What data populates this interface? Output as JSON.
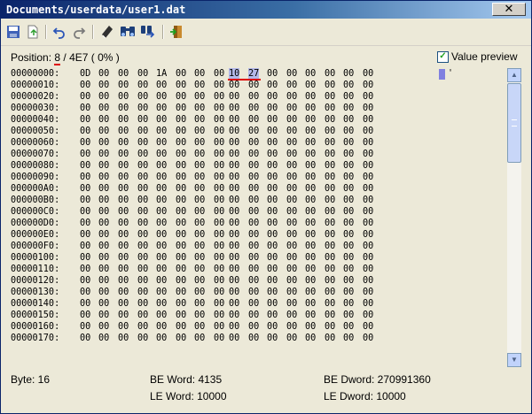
{
  "window": {
    "title": "Documents/userdata/user1.dat",
    "close_label": "✕"
  },
  "toolbar": {
    "items": [
      {
        "icon": "save-icon"
      },
      {
        "icon": "export-icon"
      },
      {
        "icon": "undo-icon"
      },
      {
        "icon": "redo-icon"
      },
      {
        "icon": "goto-icon"
      },
      {
        "icon": "find-icon"
      },
      {
        "icon": "find-next-icon"
      },
      {
        "icon": "exit-icon"
      }
    ]
  },
  "position": {
    "label": "Position:",
    "offset": "8",
    "sep": "/",
    "total": "4E7",
    "percent": "( 0% )"
  },
  "value_preview": {
    "label": "Value preview",
    "checked": true,
    "preview_char": "'"
  },
  "hex": {
    "selected_bytes": [
      8,
      9
    ],
    "rows": [
      {
        "addr": "00000000:",
        "bytes": [
          "0D",
          "00",
          "00",
          "00",
          "1A",
          "00",
          "00",
          "00",
          "10",
          "27",
          "00",
          "00",
          "00",
          "00",
          "00",
          "00"
        ]
      },
      {
        "addr": "00000010:",
        "bytes": [
          "00",
          "00",
          "00",
          "00",
          "00",
          "00",
          "00",
          "00",
          "00",
          "00",
          "00",
          "00",
          "00",
          "00",
          "00",
          "00"
        ]
      },
      {
        "addr": "00000020:",
        "bytes": [
          "00",
          "00",
          "00",
          "00",
          "00",
          "00",
          "00",
          "00",
          "00",
          "00",
          "00",
          "00",
          "00",
          "00",
          "00",
          "00"
        ]
      },
      {
        "addr": "00000030:",
        "bytes": [
          "00",
          "00",
          "00",
          "00",
          "00",
          "00",
          "00",
          "00",
          "00",
          "00",
          "00",
          "00",
          "00",
          "00",
          "00",
          "00"
        ]
      },
      {
        "addr": "00000040:",
        "bytes": [
          "00",
          "00",
          "00",
          "00",
          "00",
          "00",
          "00",
          "00",
          "00",
          "00",
          "00",
          "00",
          "00",
          "00",
          "00",
          "00"
        ]
      },
      {
        "addr": "00000050:",
        "bytes": [
          "00",
          "00",
          "00",
          "00",
          "00",
          "00",
          "00",
          "00",
          "00",
          "00",
          "00",
          "00",
          "00",
          "00",
          "00",
          "00"
        ]
      },
      {
        "addr": "00000060:",
        "bytes": [
          "00",
          "00",
          "00",
          "00",
          "00",
          "00",
          "00",
          "00",
          "00",
          "00",
          "00",
          "00",
          "00",
          "00",
          "00",
          "00"
        ]
      },
      {
        "addr": "00000070:",
        "bytes": [
          "00",
          "00",
          "00",
          "00",
          "00",
          "00",
          "00",
          "00",
          "00",
          "00",
          "00",
          "00",
          "00",
          "00",
          "00",
          "00"
        ]
      },
      {
        "addr": "00000080:",
        "bytes": [
          "00",
          "00",
          "00",
          "00",
          "00",
          "00",
          "00",
          "00",
          "00",
          "00",
          "00",
          "00",
          "00",
          "00",
          "00",
          "00"
        ]
      },
      {
        "addr": "00000090:",
        "bytes": [
          "00",
          "00",
          "00",
          "00",
          "00",
          "00",
          "00",
          "00",
          "00",
          "00",
          "00",
          "00",
          "00",
          "00",
          "00",
          "00"
        ]
      },
      {
        "addr": "000000A0:",
        "bytes": [
          "00",
          "00",
          "00",
          "00",
          "00",
          "00",
          "00",
          "00",
          "00",
          "00",
          "00",
          "00",
          "00",
          "00",
          "00",
          "00"
        ]
      },
      {
        "addr": "000000B0:",
        "bytes": [
          "00",
          "00",
          "00",
          "00",
          "00",
          "00",
          "00",
          "00",
          "00",
          "00",
          "00",
          "00",
          "00",
          "00",
          "00",
          "00"
        ]
      },
      {
        "addr": "000000C0:",
        "bytes": [
          "00",
          "00",
          "00",
          "00",
          "00",
          "00",
          "00",
          "00",
          "00",
          "00",
          "00",
          "00",
          "00",
          "00",
          "00",
          "00"
        ]
      },
      {
        "addr": "000000D0:",
        "bytes": [
          "00",
          "00",
          "00",
          "00",
          "00",
          "00",
          "00",
          "00",
          "00",
          "00",
          "00",
          "00",
          "00",
          "00",
          "00",
          "00"
        ]
      },
      {
        "addr": "000000E0:",
        "bytes": [
          "00",
          "00",
          "00",
          "00",
          "00",
          "00",
          "00",
          "00",
          "00",
          "00",
          "00",
          "00",
          "00",
          "00",
          "00",
          "00"
        ]
      },
      {
        "addr": "000000F0:",
        "bytes": [
          "00",
          "00",
          "00",
          "00",
          "00",
          "00",
          "00",
          "00",
          "00",
          "00",
          "00",
          "00",
          "00",
          "00",
          "00",
          "00"
        ]
      },
      {
        "addr": "00000100:",
        "bytes": [
          "00",
          "00",
          "00",
          "00",
          "00",
          "00",
          "00",
          "00",
          "00",
          "00",
          "00",
          "00",
          "00",
          "00",
          "00",
          "00"
        ]
      },
      {
        "addr": "00000110:",
        "bytes": [
          "00",
          "00",
          "00",
          "00",
          "00",
          "00",
          "00",
          "00",
          "00",
          "00",
          "00",
          "00",
          "00",
          "00",
          "00",
          "00"
        ]
      },
      {
        "addr": "00000120:",
        "bytes": [
          "00",
          "00",
          "00",
          "00",
          "00",
          "00",
          "00",
          "00",
          "00",
          "00",
          "00",
          "00",
          "00",
          "00",
          "00",
          "00"
        ]
      },
      {
        "addr": "00000130:",
        "bytes": [
          "00",
          "00",
          "00",
          "00",
          "00",
          "00",
          "00",
          "00",
          "00",
          "00",
          "00",
          "00",
          "00",
          "00",
          "00",
          "00"
        ]
      },
      {
        "addr": "00000140:",
        "bytes": [
          "00",
          "00",
          "00",
          "00",
          "00",
          "00",
          "00",
          "00",
          "00",
          "00",
          "00",
          "00",
          "00",
          "00",
          "00",
          "00"
        ]
      },
      {
        "addr": "00000150:",
        "bytes": [
          "00",
          "00",
          "00",
          "00",
          "00",
          "00",
          "00",
          "00",
          "00",
          "00",
          "00",
          "00",
          "00",
          "00",
          "00",
          "00"
        ]
      },
      {
        "addr": "00000160:",
        "bytes": [
          "00",
          "00",
          "00",
          "00",
          "00",
          "00",
          "00",
          "00",
          "00",
          "00",
          "00",
          "00",
          "00",
          "00",
          "00",
          "00"
        ]
      },
      {
        "addr": "00000170:",
        "bytes": [
          "00",
          "00",
          "00",
          "00",
          "00",
          "00",
          "00",
          "00",
          "00",
          "00",
          "00",
          "00",
          "00",
          "00",
          "00",
          "00"
        ]
      }
    ]
  },
  "status": {
    "byte": "Byte: 16",
    "be_word": "BE Word: 4135",
    "le_word": "LE Word: 10000",
    "be_dword": "BE Dword: 270991360",
    "le_dword": "LE Dword: 10000"
  },
  "colors": {
    "selection": "#B3B8E8",
    "highlight_line": "#DD0000",
    "title_bar": "#0A246A"
  }
}
